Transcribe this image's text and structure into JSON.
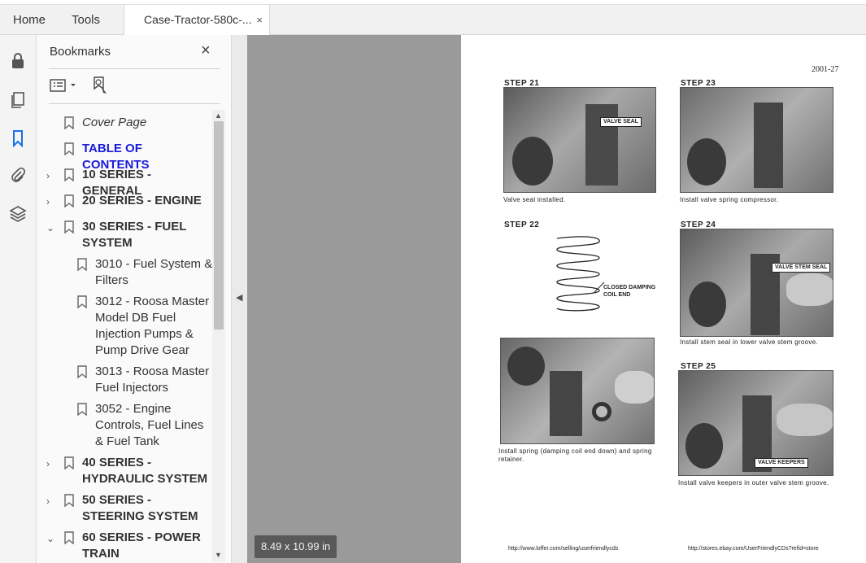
{
  "tabs": {
    "home": "Home",
    "tools": "Tools",
    "document": "Case-Tractor-580c-...",
    "close": "×"
  },
  "bookmarks": {
    "title": "Bookmarks",
    "close": "×",
    "items": [
      {
        "label": "Cover Page",
        "level": 0,
        "expander": "",
        "style": "italic"
      },
      {
        "label": "TABLE OF CONTENTS",
        "level": 0,
        "expander": "",
        "style": "blue"
      },
      {
        "label": "10 SERIES - GENERAL",
        "level": 0,
        "expander": "›",
        "style": ""
      },
      {
        "label": "20 SERIES - ENGINE",
        "level": 0,
        "expander": "›",
        "style": ""
      },
      {
        "label": "30 SERIES - FUEL SYSTEM",
        "level": 0,
        "expander": "⌄",
        "style": ""
      },
      {
        "label": "3010 - Fuel System & Filters",
        "level": 1,
        "expander": "",
        "style": ""
      },
      {
        "label": "3012 - Roosa Master Model DB Fuel Injection Pumps & Pump Drive Gear",
        "level": 1,
        "expander": "",
        "style": ""
      },
      {
        "label": "3013 - Roosa Master Fuel Injectors",
        "level": 1,
        "expander": "",
        "style": ""
      },
      {
        "label": "3052 - Engine Controls, Fuel Lines & Fuel Tank",
        "level": 1,
        "expander": "",
        "style": ""
      },
      {
        "label": "40 SERIES - HYDRAULIC SYSTEM",
        "level": 0,
        "expander": "›",
        "style": ""
      },
      {
        "label": "50 SERIES - STEERING SYSTEM",
        "level": 0,
        "expander": "›",
        "style": ""
      },
      {
        "label": "60 SERIES - POWER TRAIN",
        "level": 0,
        "expander": "⌄",
        "style": ""
      }
    ]
  },
  "viewer": {
    "page_size": "8.49 x 10.99 in"
  },
  "page": {
    "number": "2001-27",
    "steps": {
      "s21": "STEP 21",
      "s22": "STEP 22",
      "s23": "STEP 23",
      "s24": "STEP 24",
      "s25": "STEP 25"
    },
    "captions": {
      "c21": "Valve seal installed.",
      "c23": "Install valve spring compressor.",
      "c24": "Install stem seal in lower valve stem groove.",
      "cspring": "Install spring (damping coil end down) and spring retainer.",
      "c25": "Install valve keepers in outer valve stem groove."
    },
    "callouts": {
      "valve_seal": "VALVE SEAL",
      "valve_stem_seal": "VALVE STEM SEAL",
      "valve_keepers": "VALVE KEEPERS",
      "coil_end": "CLOSED DAMPING COIL END"
    },
    "urls": {
      "left": "http://www.loffer.com/selling/userfriendlycds",
      "right": "http://stores.ebay.com/UserFriendlyCDs?refid=store"
    }
  },
  "colors": {
    "toc_link": "#1a1adb",
    "viewer_bg": "#9a9a9a"
  }
}
